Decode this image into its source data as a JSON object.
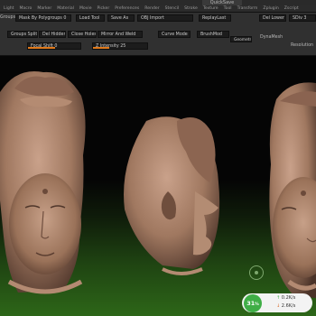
{
  "title_bar": {
    "quicksave": "QuickSave"
  },
  "menu": [
    "Light",
    "Macro",
    "Marker",
    "Material",
    "Movie",
    "Picker",
    "Preferences",
    "Render",
    "Stencil",
    "Stroke",
    "Texture",
    "Tool",
    "Transform",
    "Zplugin",
    "Zscript"
  ],
  "toolbar": {
    "row1": {
      "groups_label": "Groups",
      "mask_by_polygroups": "Mask By Polygroups 0",
      "load_tool": "Load Tool",
      "save_as": "Save As",
      "obj_import": "OBJ Import",
      "replay_last": "ReplayLast",
      "del_lower": "Del Lower",
      "sdiv": "SDiv 3"
    },
    "row2": {
      "groups_split": "Groups Split",
      "del_hidden": "Del Hidden",
      "close_holes": "Close Holes",
      "mirror_and_weld": "Mirror And Weld",
      "curve_mode": "Curve Mode",
      "brushmod": "BrushMod",
      "dynamesh": "DynaMesh",
      "geometry": "Geometry"
    },
    "row3": {
      "focal_shift": "Focal Shift 0",
      "z_intensity": "Z Intensity 25",
      "resolution": "Resolution"
    }
  },
  "viewport": {
    "colors": {
      "clay": "#a07860",
      "clay_dark": "#5a3e30",
      "clay_light": "#c49c84",
      "floor_green": "#2d6618"
    }
  },
  "hud": {
    "percent": "31",
    "percent_unit": "%",
    "upload": "0.2K/s",
    "download": "2.6K/s",
    "percent_value": 31
  }
}
